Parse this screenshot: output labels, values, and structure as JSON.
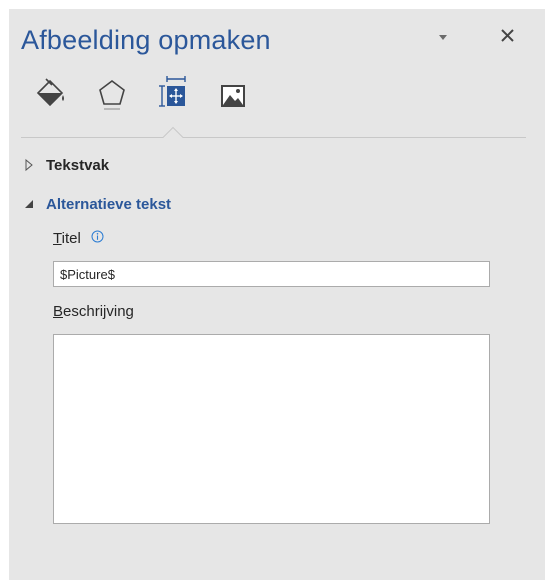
{
  "pane": {
    "title": "Afbeelding opmaken",
    "dropdown_icon": "chevron-down-icon",
    "close_icon": "close-icon"
  },
  "tabs": [
    {
      "name": "fill-and-line",
      "icon": "paint-bucket-icon"
    },
    {
      "name": "effects",
      "icon": "pentagon-icon"
    },
    {
      "name": "size-and-properties",
      "icon": "size-properties-icon",
      "selected": true
    },
    {
      "name": "picture",
      "icon": "picture-icon"
    }
  ],
  "sections": {
    "textbox": {
      "label": "Tekstvak",
      "expanded": false
    },
    "alt_text": {
      "label": "Alternatieve tekst",
      "expanded": true
    }
  },
  "fields": {
    "title_label_first": "T",
    "title_label_rest": "itel",
    "title_value": "$Picture$",
    "description_label_first": "B",
    "description_label_rest": "eschrijving",
    "description_value": ""
  },
  "colors": {
    "accent": "#2b579a",
    "pane_bg": "#e6e6e6",
    "text": "#262626"
  }
}
